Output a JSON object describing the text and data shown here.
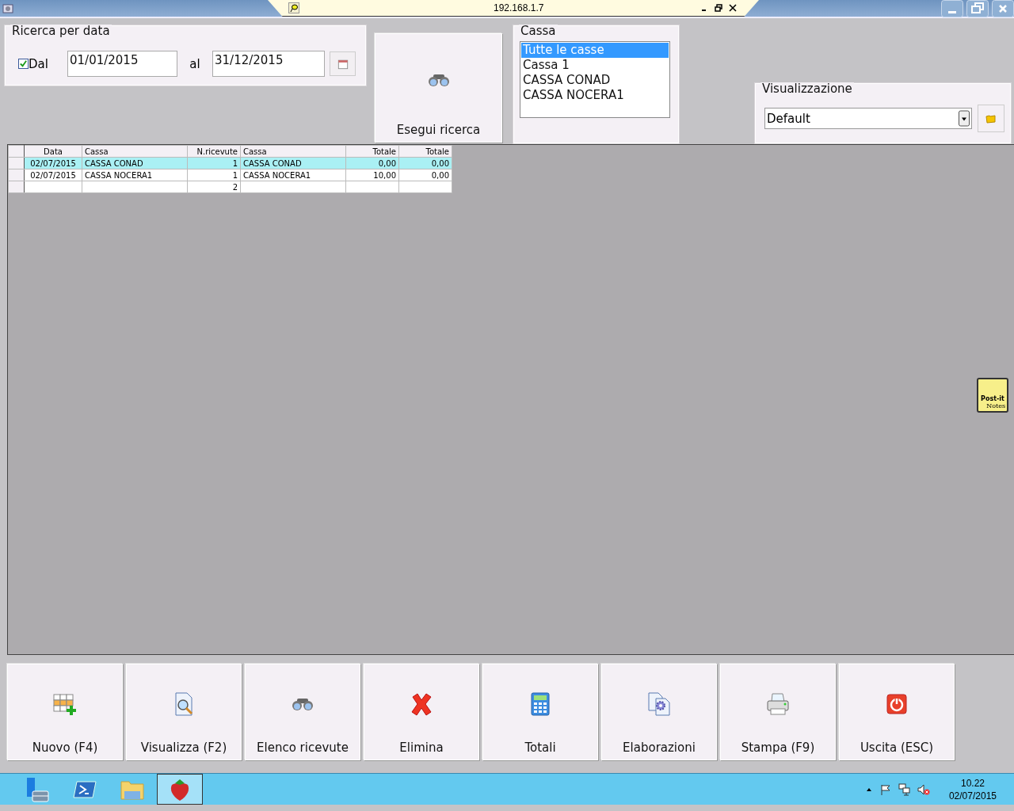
{
  "window": {
    "remote_host": "192.168.1.7"
  },
  "date_search": {
    "title": "Ricerca per data",
    "from_checkbox": {
      "label": "Dal",
      "checked": true
    },
    "from_value": "01/01/2015",
    "to_label": "al",
    "to_value": "31/12/2015"
  },
  "search_button": {
    "label": "Esegui ricerca"
  },
  "cassa": {
    "title": "Cassa",
    "items": [
      {
        "label": "Tutte le casse",
        "selected": true
      },
      {
        "label": "Cassa 1",
        "selected": false
      },
      {
        "label": "CASSA CONAD",
        "selected": false
      },
      {
        "label": "CASSA NOCERA1",
        "selected": false
      }
    ]
  },
  "view": {
    "title": "Visualizzazione",
    "value": "Default"
  },
  "table": {
    "columns": [
      "Data",
      "Cassa",
      "N.ricevute",
      "Cassa",
      "Totale",
      "Totale"
    ],
    "rows": [
      {
        "selected": true,
        "cells": [
          "02/07/2015",
          "CASSA CONAD",
          "1",
          "CASSA CONAD",
          "0,00",
          "0,00"
        ]
      },
      {
        "selected": false,
        "cells": [
          "02/07/2015",
          "CASSA NOCERA1",
          "1",
          "CASSA NOCERA1",
          "10,00",
          "0,00"
        ]
      },
      {
        "selected": false,
        "cells": [
          null,
          null,
          "2",
          null,
          null,
          null
        ]
      }
    ]
  },
  "postit": {
    "brand": "Post-it",
    "caption": "Notes"
  },
  "actions": [
    {
      "label": "Nuovo (F4)",
      "kind": "new"
    },
    {
      "label": "Visualizza (F2)",
      "kind": "view"
    },
    {
      "label": "Elenco ricevute",
      "kind": "list"
    },
    {
      "label": "Elimina",
      "kind": "delete"
    },
    {
      "label": "Totali",
      "kind": "totals"
    },
    {
      "label": "Elaborazioni",
      "kind": "process"
    },
    {
      "label": "Stampa (F9)",
      "kind": "print"
    },
    {
      "label": "Uscita (ESC)",
      "kind": "exit"
    }
  ],
  "taskbar": {
    "apps": [
      {
        "kind": "server",
        "selected": false
      },
      {
        "kind": "shell",
        "selected": false
      },
      {
        "kind": "folder",
        "selected": false
      },
      {
        "kind": "strawberry",
        "selected": true
      }
    ],
    "time": "10.22",
    "date": "02/07/2015"
  }
}
